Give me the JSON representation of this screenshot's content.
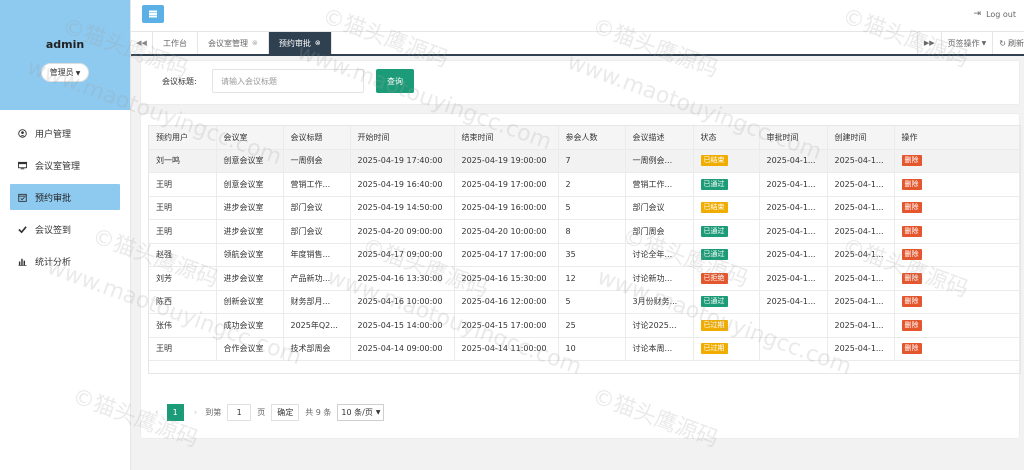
{
  "sidebar": {
    "username": "admin",
    "role": "管理员",
    "menu": [
      {
        "label": "用户管理",
        "icon": "user-circle-icon",
        "active": false
      },
      {
        "label": "会议室管理",
        "icon": "monitor-icon",
        "active": false
      },
      {
        "label": "预约审批",
        "icon": "calendar-check-icon",
        "active": true
      },
      {
        "label": "会议签到",
        "icon": "check-icon",
        "active": false
      },
      {
        "label": "统计分析",
        "icon": "bar-chart-icon",
        "active": false
      }
    ]
  },
  "topbar": {
    "logout_label": "Log out"
  },
  "tabs": {
    "items": [
      {
        "label": "工作台",
        "closable": false,
        "active": false
      },
      {
        "label": "会议室管理",
        "closable": true,
        "active": false
      },
      {
        "label": "预约审批",
        "closable": true,
        "active": true
      }
    ],
    "page_ops_label": "页签操作",
    "refresh_label": "刷新"
  },
  "search": {
    "label": "会议标题:",
    "placeholder": "请输入会议标题",
    "button_label": "查询"
  },
  "table": {
    "columns": [
      "预约用户",
      "会议室",
      "会议标题",
      "开始时间",
      "结束时间",
      "参会人数",
      "会议描述",
      "状态",
      "审批时间",
      "创建时间",
      "操作"
    ],
    "delete_label": "删除",
    "status_colors": {
      "已结束": "#f0ad00",
      "已通过": "#1c9b78",
      "已拒绝": "#e4572e",
      "已过期": "#f0ad00"
    },
    "rows": [
      [
        "刘一鸣",
        "创意会议室",
        "一周例会",
        "2025-04-19 17:40:00",
        "2025-04-19 19:00:00",
        "7",
        "一周例会...",
        "已结束",
        "2025-04-1...",
        "2025-04-1..."
      ],
      [
        "王明",
        "创意会议室",
        "营销工作...",
        "2025-04-19 16:40:00",
        "2025-04-19 17:00:00",
        "2",
        "营销工作...",
        "已通过",
        "2025-04-1...",
        "2025-04-1..."
      ],
      [
        "王明",
        "进步会议室",
        "部门会议",
        "2025-04-19 14:50:00",
        "2025-04-19 16:00:00",
        "5",
        "部门会议",
        "已结束",
        "2025-04-1...",
        "2025-04-1..."
      ],
      [
        "王明",
        "进步会议室",
        "部门会议",
        "2025-04-20 09:00:00",
        "2025-04-20 10:00:00",
        "8",
        "部门周会",
        "已通过",
        "2025-04-1...",
        "2025-04-1..."
      ],
      [
        "赵强",
        "领航会议室",
        "年度销售...",
        "2025-04-17 09:00:00",
        "2025-04-17 17:00:00",
        "35",
        "讨论全年...",
        "已通过",
        "2025-04-1...",
        "2025-04-1..."
      ],
      [
        "刘芳",
        "进步会议室",
        "产品新功...",
        "2025-04-16 13:30:00",
        "2025-04-16 15:30:00",
        "12",
        "讨论新功...",
        "已拒绝",
        "2025-04-1...",
        "2025-04-1..."
      ],
      [
        "陈西",
        "创新会议室",
        "财务部月...",
        "2025-04-16 10:00:00",
        "2025-04-16 12:00:00",
        "5",
        "3月份财务...",
        "已通过",
        "2025-04-1...",
        "2025-04-1..."
      ],
      [
        "张伟",
        "成功会议室",
        "2025年Q2...",
        "2025-04-15 14:00:00",
        "2025-04-15 17:00:00",
        "25",
        "讨论2025...",
        "已过期",
        "",
        "2025-04-1..."
      ],
      [
        "王明",
        "合作会议室",
        "技术部周会",
        "2025-04-14 09:00:00",
        "2025-04-14 11:00:00",
        "10",
        "讨论本周...",
        "已过期",
        "",
        "2025-04-1..."
      ]
    ]
  },
  "pagination": {
    "current_page": "1",
    "goto_label": "到第",
    "goto_value": "1",
    "page_label": "页",
    "confirm_label": "确定",
    "total_label": "共 9 条",
    "page_size_label": "10 条/页"
  },
  "watermark": {
    "text_cn": "©猫头鹰源码",
    "text_url": "www.maotouyingcc.com"
  }
}
